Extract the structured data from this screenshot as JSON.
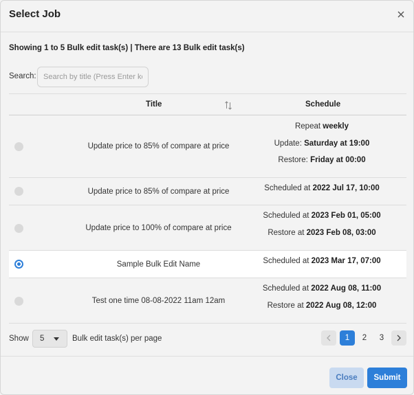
{
  "dialog": {
    "title": "Select Job"
  },
  "summary": "Showing 1 to 5 Bulk edit task(s) | There are 13 Bulk edit task(s)",
  "search": {
    "label": "Search:",
    "placeholder": "Search by title (Press Enter key)",
    "value": ""
  },
  "table": {
    "columns": {
      "title": "Title",
      "schedule": "Schedule"
    },
    "rows": [
      {
        "title": "Update price to 85% of compare at price",
        "selected": false,
        "schedule": [
          {
            "prefix": "Repeat",
            "bold": "weekly"
          },
          {
            "prefix": "Update:",
            "bold": "Saturday at 19:00"
          },
          {
            "prefix": "Restore:",
            "bold": "Friday at 00:00"
          }
        ]
      },
      {
        "title": "Update price to 85% of compare at price",
        "selected": false,
        "schedule": [
          {
            "prefix": "Scheduled at",
            "bold": "2022 Jul 17, 10:00"
          }
        ]
      },
      {
        "title": "Update price to 100% of compare at price",
        "selected": false,
        "schedule": [
          {
            "prefix": "Scheduled at",
            "bold": "2023 Feb 01, 05:00"
          },
          {
            "prefix": "Restore at",
            "bold": "2023 Feb 08, 03:00"
          }
        ]
      },
      {
        "title": "Sample Bulk Edit Name",
        "selected": true,
        "schedule": [
          {
            "prefix": "Scheduled at",
            "bold": "2023 Mar 17, 07:00"
          }
        ]
      },
      {
        "title": "Test one time 08-08-2022 11am 12am",
        "selected": false,
        "schedule": [
          {
            "prefix": "Scheduled at",
            "bold": "2022 Aug 08, 11:00"
          },
          {
            "prefix": "Restore at",
            "bold": "2022 Aug 08, 12:00"
          }
        ]
      }
    ]
  },
  "pagination": {
    "show_label": "Show",
    "per_page": "5",
    "per_page_text": "Bulk edit task(s) per page",
    "pages": [
      "1",
      "2",
      "3"
    ],
    "current_page": "1"
  },
  "buttons": {
    "close": "Close",
    "submit": "Submit"
  },
  "colors": {
    "accent": "#2d7fd9",
    "close_bg": "#c9daf0",
    "background": "#f3f3f3"
  }
}
